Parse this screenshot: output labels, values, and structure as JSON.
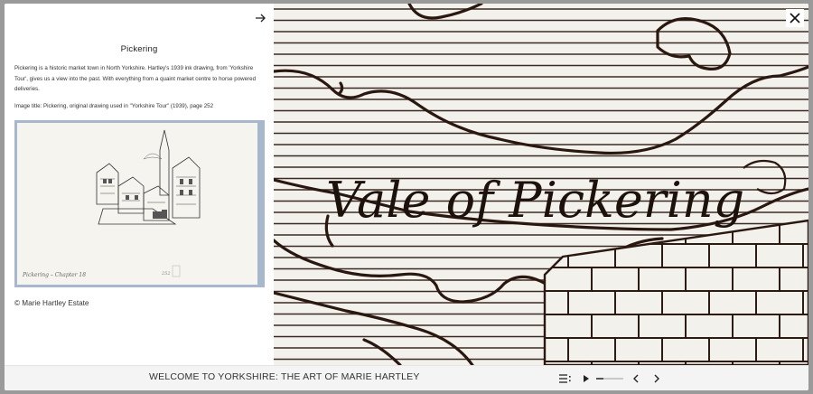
{
  "panel": {
    "title": "Pickering",
    "description": "Pickering is a historic market town in North Yorkshire. Hartley's 1939 ink drawing, from 'Yorkshire Tour', gives us a view into the past. With everything from a quaint market centre to horse powered deliveries.",
    "image_title": "Image title: Pickering, original drawing used in \"Yorkshire Tour\" (1939), page 252",
    "credit": "© Marie Hartley Estate",
    "next_icon": "arrow-right-icon"
  },
  "thumbnail": {
    "caption": "Pickering – Chapter 18",
    "stamp": "252"
  },
  "map": {
    "label": "Vale of Pickering",
    "ink_color": "#2a1810",
    "paper_color": "#f3f1ec"
  },
  "footer": {
    "title": "WELCOME TO YORKSHIRE: THE ART OF MARIE HARTLEY",
    "progress": 0.25,
    "icons": [
      "list-icon",
      "play-icon",
      "chevron-left-icon",
      "chevron-right-icon"
    ]
  },
  "close_icon": "close-icon"
}
